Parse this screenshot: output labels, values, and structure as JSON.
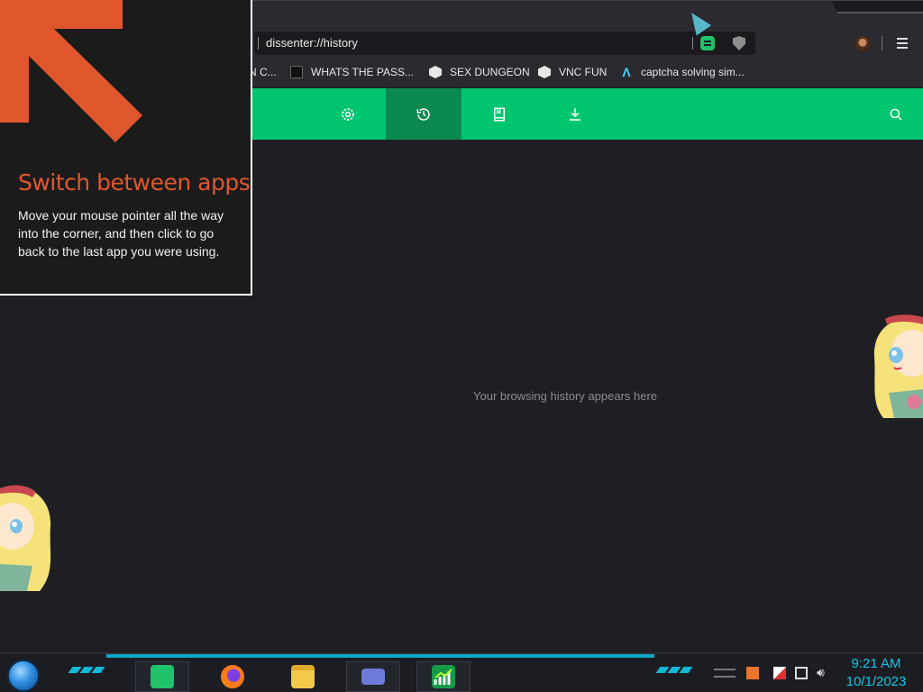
{
  "browser": {
    "url": "dissenter://history",
    "bookmarks": [
      {
        "label": "N C...",
        "icon": "partial-icon"
      },
      {
        "label": "WHATS THE PASS...",
        "icon": "terminal-icon"
      },
      {
        "label": "SEX DUNGEON",
        "icon": "cube-icon"
      },
      {
        "label": "VNC FUN",
        "icon": "cube-icon"
      },
      {
        "label": "captcha solving sim...",
        "icon": "lambda-icon"
      }
    ],
    "accent_color": "#00c56f",
    "nav": [
      {
        "name": "settings",
        "icon": "gear-icon",
        "active": false
      },
      {
        "name": "history",
        "icon": "clock-history-icon",
        "active": true
      },
      {
        "name": "bookmarks",
        "icon": "bookmark-icon",
        "active": false
      },
      {
        "name": "downloads",
        "icon": "download-icon",
        "active": false
      }
    ]
  },
  "history": {
    "empty_message": "Your browsing history appears here"
  },
  "tip": {
    "title": "Switch between apps",
    "body": "Move your mouse pointer all the way into the corner, and then click to go back to the last app you were using.",
    "accent_color": "#e0572e"
  },
  "taskbar": {
    "apps": [
      {
        "name": "notes-app",
        "icon": "note-icon"
      },
      {
        "name": "firefox",
        "icon": "firefox-icon"
      },
      {
        "name": "file-explorer",
        "icon": "folder-icon"
      },
      {
        "name": "window-app",
        "icon": "window-icon"
      },
      {
        "name": "chart-app",
        "icon": "chart-icon"
      }
    ],
    "clock": {
      "time": "9:21 AM",
      "date": "10/1/2023"
    }
  }
}
